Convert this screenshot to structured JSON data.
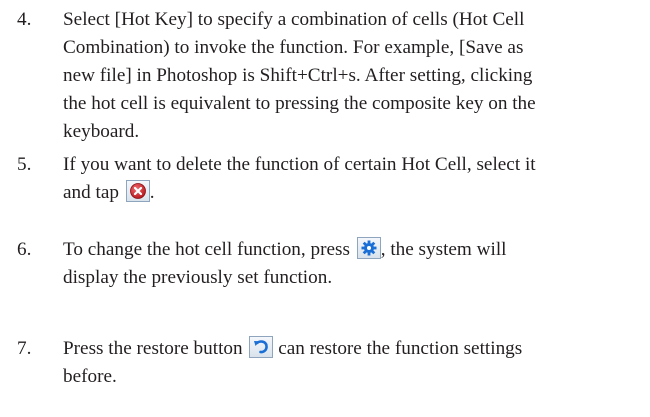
{
  "items": [
    {
      "number": "4.",
      "lines": [
        "Select [Hot Key] to specify a combination of cells (Hot Cell",
        "Combination) to invoke the function. For example, [Save as",
        "new file] in Photoshop is Shift+Ctrl+s. After setting, clicking",
        "the hot cell is equivalent to pressing the composite key on the",
        "keyboard."
      ]
    },
    {
      "number": "5.",
      "line1": "If you want to delete the function of certain Hot Cell, select it",
      "line2_before": "and tap",
      "line2_after": ".",
      "icon": "delete-icon"
    },
    {
      "number": "6.",
      "line1_before": "To change the hot cell function, press",
      "line1_after": ", the system will",
      "line2": "display the previously set function.",
      "icon": "settings-gear-icon"
    },
    {
      "number": "7.",
      "line1_before": "Press the restore button",
      "line1_after": "can restore the function settings",
      "line2": "before.",
      "icon": "restore-undo-icon"
    }
  ],
  "colors": {
    "text": "#231f20",
    "delete_icon": "#d7262c",
    "settings_icon": "#1a6fd6",
    "restore_icon": "#1a6fd6"
  }
}
